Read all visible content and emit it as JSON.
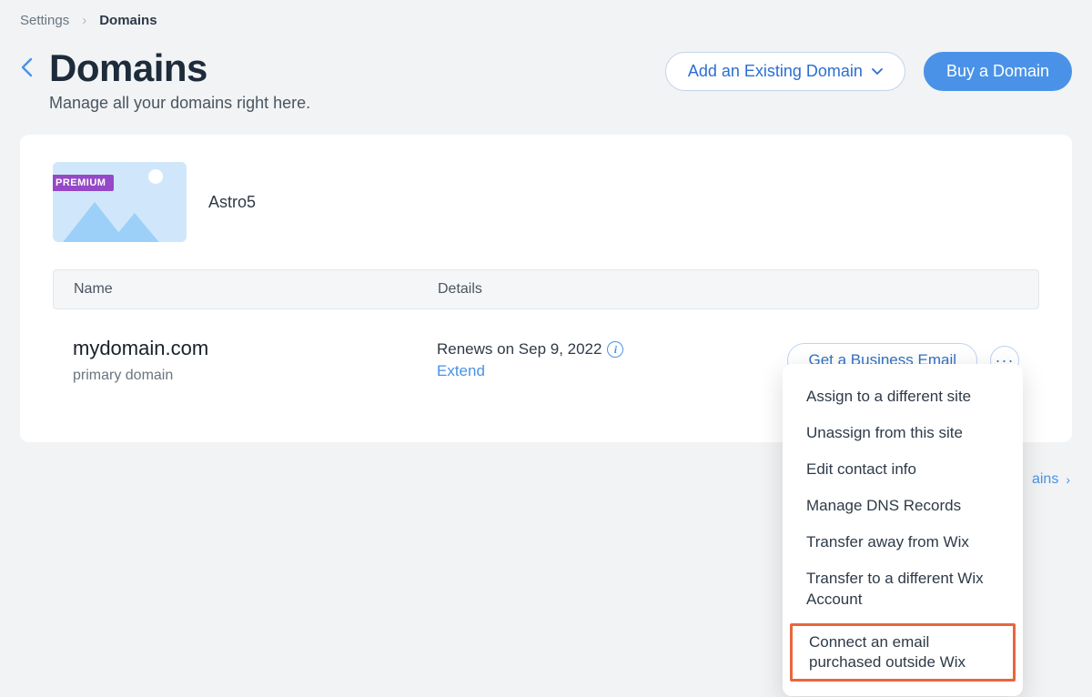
{
  "breadcrumb": {
    "root": "Settings",
    "current": "Domains"
  },
  "header": {
    "title": "Domains",
    "subtitle": "Manage all your domains right here.",
    "add_button": "Add an Existing Domain",
    "buy_button": "Buy a Domain"
  },
  "site": {
    "badge": "PREMIUM",
    "name": "Astro5"
  },
  "table": {
    "col_name": "Name",
    "col_details": "Details"
  },
  "domain": {
    "name": "mydomain.com",
    "sub": "primary domain",
    "renew_text": "Renews on Sep 9, 2022",
    "extend": "Extend",
    "get_email": "Get a Business Email"
  },
  "menu": {
    "items": [
      "Assign to a different site",
      "Unassign from this site",
      "Edit contact info",
      "Manage DNS Records",
      "Transfer away from Wix",
      "Transfer to a different Wix Account",
      "Connect an email purchased outside Wix"
    ]
  },
  "footer": {
    "partial": "ains"
  }
}
